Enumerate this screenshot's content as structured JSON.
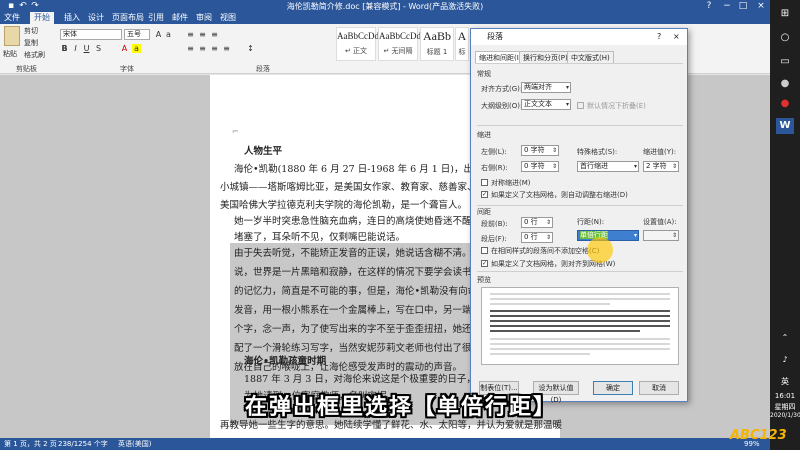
{
  "window": {
    "title": "海伦凯勒简介修.doc [兼容模式] - Word(产品激活失败)",
    "help_label": "?"
  },
  "ribbon_tabs": [
    "文件",
    "开始",
    "插入",
    "设计",
    "页面布局",
    "引用",
    "邮件",
    "审阅",
    "视图"
  ],
  "ribbon": {
    "paste_label": "粘贴",
    "cut_label": "剪切",
    "copy_label": "复制",
    "format_painter_label": "格式刷",
    "font_name": "宋体",
    "font_size": "五号",
    "clipboard_group": "剪贴板",
    "font_group": "字体",
    "paragraph_group": "段落",
    "styles": [
      {
        "preview": "AaBbCcDd",
        "name": "↵ 正文"
      },
      {
        "preview": "AaBbCcDd",
        "name": "↵ 无间隔"
      },
      {
        "preview": "AaBb",
        "name": "标题 1"
      },
      {
        "preview": "A",
        "name": "标"
      }
    ]
  },
  "document": {
    "lines": [
      {
        "text": "人物生平",
        "bold": true,
        "selected": false
      },
      {
        "text": "海伦•凯勒(1880 年 6 月 27 日-1968 年 6 月 1 日)，出生于亚拉",
        "bold": false,
        "selected": false
      },
      {
        "text": "小城镇——塔斯喀姆比亚，是美国女作家、教育家、慈善家、社会",
        "bold": false,
        "selected": false
      },
      {
        "text": "美国哈佛大学拉德克利夫学院的海伦凯勒，是一个聋盲人。",
        "bold": false,
        "selected": false
      },
      {
        "text": "她一岁半时突患急性脑充血病，连日的高烧使她昏迷不醒。",
        "bold": false,
        "selected": false
      },
      {
        "text": "堵塞了，耳朵听不见，仅剩嘴巴能说话。",
        "bold": false,
        "selected": false
      },
      {
        "text": "由于失去听觉，不能矫正发音的正误，她说话含糊不清。从",
        "bold": false,
        "selected": true
      },
      {
        "text": "说，世界是一片黑暗和寂静，在这样的情况下要学会读书、写字",
        "bold": false,
        "selected": true
      },
      {
        "text": "的记忆力，简直是不可能的事，但是，海伦•凯勒没有向命运屈服",
        "bold": false,
        "selected": true
      },
      {
        "text": "发音，用一根小熊系在一个金属棒上，写在口中，另一端拿在手上",
        "bold": false,
        "selected": true
      },
      {
        "text": "个字，念一声，为了使写出来的字不至于歪歪扭扭，她还自",
        "bold": false,
        "selected": true
      },
      {
        "text": "配了一个滑轮练习写字，当然安妮莎莉文老师也付出了很大的贡献",
        "bold": false,
        "selected": true
      },
      {
        "text": "放在自己的喉咙上，让海伦感受发声时的震动的声音。",
        "bold": false,
        "selected": true
      },
      {
        "text": "海伦•凯勒孩童时期",
        "bold": true,
        "selected": false
      },
      {
        "text": "1887 年 3 月 3 日，对海伦来说这是个极重要的日子，这一天",
        "bold": false,
        "selected": false
      },
      {
        "text": "为她请到一位家庭教师，名叫安妮",
        "bold": false,
        "selected": false
      },
      {
        "text": "再教导她一些生字的意思。她陆续学懂了鲜花、水、太阳等，并认为爱就是那温暖",
        "bold": false,
        "selected": false
      }
    ]
  },
  "status_bar": {
    "page": "第 1 页，共 2 页",
    "words": "238/1254 个字",
    "language": "英语(美国)",
    "zoom": "99%"
  },
  "dialog": {
    "title": "段落",
    "tabs": [
      "缩进和间距(I)",
      "换行和分页(P)",
      "中文版式(H)"
    ],
    "general": {
      "heading": "常规",
      "alignment_label": "对齐方式(G):",
      "alignment_value": "两端对齐",
      "outline_label": "大纲级别(O):",
      "outline_value": "正文文本",
      "collapsed_label": "默认情况下折叠(E)"
    },
    "indent": {
      "heading": "缩进",
      "left_label": "左侧(L):",
      "left_value": "0 字符",
      "right_label": "右侧(R):",
      "right_value": "0 字符",
      "special_label": "特殊格式(S):",
      "special_value": "首行缩进",
      "by_label": "缩进值(Y):",
      "by_value": "2 字符",
      "mirror_label": "对称缩进(M)",
      "auto_adjust_label": "如果定义了文档网格，则自动调整右缩进(D)"
    },
    "spacing": {
      "heading": "间距",
      "before_label": "段前(B):",
      "before_value": "0 行",
      "after_label": "段后(F):",
      "after_value": "0 行",
      "line_spacing_label": "行距(N):",
      "line_spacing_value": "单倍行距",
      "at_label": "设置值(A):",
      "at_value": "",
      "no_space_label": "在相同样式的段落间不添加空格(C)",
      "snap_grid_label": "如果定义了文档网格，则对齐到网格(W)"
    },
    "preview_heading": "预览",
    "buttons": {
      "tabs": "制表位(T)...",
      "set_default": "设为默认值(D)",
      "ok": "确定",
      "cancel": "取消"
    }
  },
  "subtitle": "在弹出框里选择【单倍行距】",
  "taskbar": {
    "ime": "英",
    "time": "16:01",
    "weekday": "星期四",
    "date": "2020/1/30"
  },
  "watermark": "ABC123"
}
